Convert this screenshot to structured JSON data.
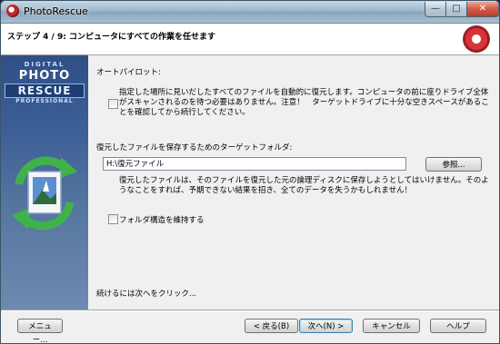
{
  "window": {
    "title": "PhotoRescue"
  },
  "header": {
    "title": "ステップ 4 / 9: コンピュータにすべての作業を任せます"
  },
  "sidebar": {
    "brand_line1": "DIGITAL",
    "brand_line2": "PHOTO",
    "brand_line3": "RESCUE",
    "brand_line4": "PROFESSIONAL"
  },
  "autopilot": {
    "label": "オートパイロット:",
    "text": "指定した場所に見いだしたすべてのファイルを自動的に復元します。コンピュータの前に座りドライブ全体がスキャンされるのを待つ必要はありません。注意！　ターゲットドライブに十分な空きスペースがあることを確認してから続行してください。"
  },
  "target": {
    "label": "復元したファイルを保存するためのターゲットフォルダ:",
    "value": "H:\\復元ファイル",
    "browse_label": "参照...",
    "warning": "復元したファイルは、そのファイルを復元した元の論理ディスクに保存しようとしてはいけません。そのようなことをすれば、予期できない結果を招き、全てのデータを失うかもしれません！"
  },
  "keep_structure": {
    "label": "フォルダ構造を維持する"
  },
  "footer_hint": "続けるには次へをクリック...",
  "buttons": {
    "menu": "メニュー...",
    "back": "< 戻る(B)",
    "next": "次へ(N) >",
    "cancel": "キャンセル",
    "help": "ヘルプ"
  },
  "colors": {
    "sidebar": "#3d5f97",
    "accent": "#3c7fb1",
    "close": "#cf5c44"
  }
}
